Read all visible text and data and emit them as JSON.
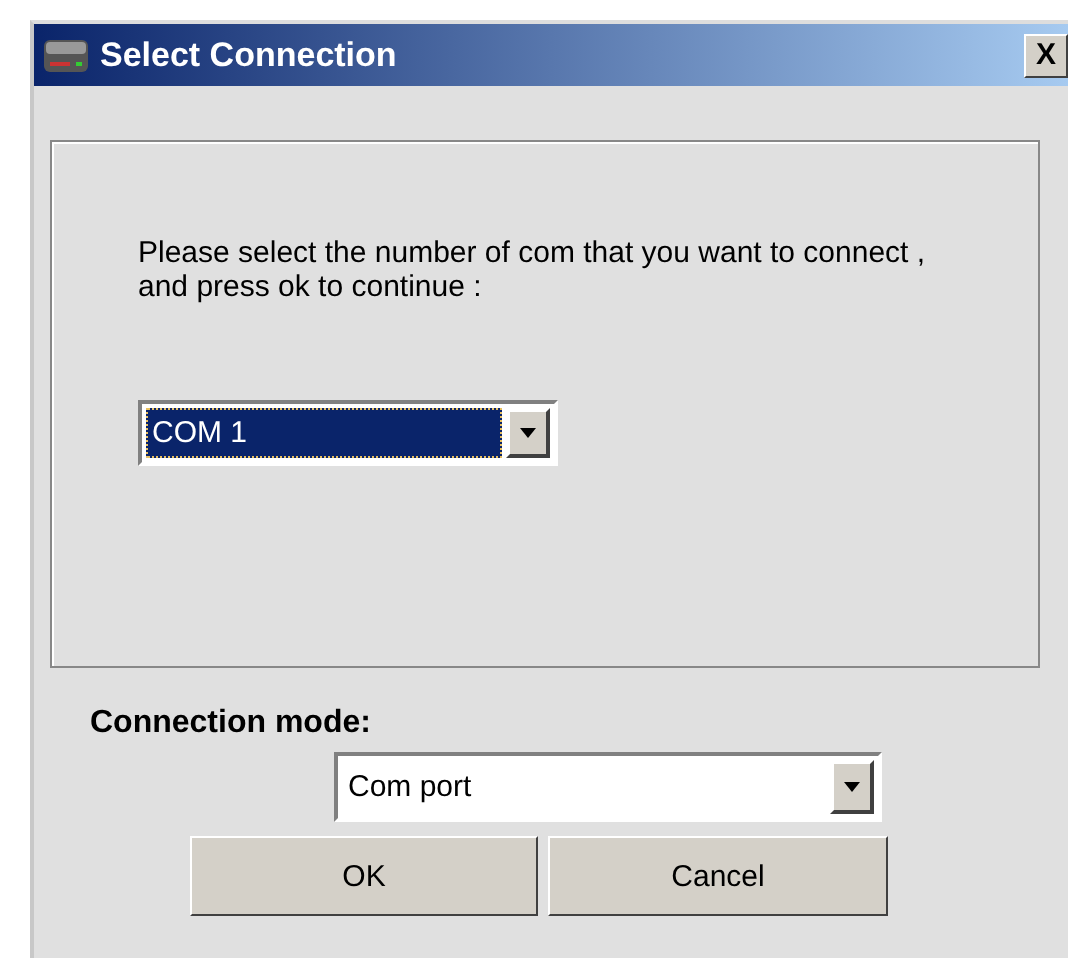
{
  "window": {
    "title": "Select Connection",
    "close": "X"
  },
  "prompt": "Please select the number of com that you want to connect , and press ok to continue :",
  "port_select": {
    "value": "COM 1",
    "focused": true
  },
  "mode_label": "Connection mode:",
  "mode_select": {
    "value": "Com port",
    "focused": false
  },
  "buttons": [
    {
      "label": "OK"
    },
    {
      "label": "Cancel"
    }
  ]
}
